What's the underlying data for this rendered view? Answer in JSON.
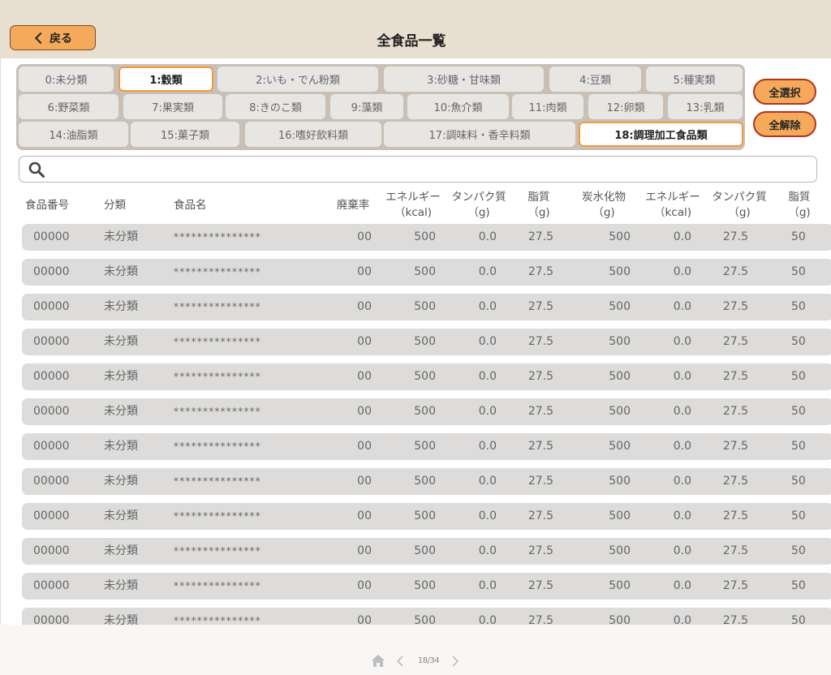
{
  "header": {
    "back_label": "戻る",
    "title": "全食品一覧"
  },
  "categories": [
    {
      "label": "0:未分類",
      "selected": false
    },
    {
      "label": "1:穀類",
      "selected": true
    },
    {
      "label": "2:いも・でん粉類",
      "selected": false
    },
    {
      "label": "3:砂糖・甘味類",
      "selected": false
    },
    {
      "label": "4:豆類",
      "selected": false
    },
    {
      "label": "5:種実類",
      "selected": false
    },
    {
      "label": "6:野菜類",
      "selected": false
    },
    {
      "label": "7:果実類",
      "selected": false
    },
    {
      "label": "8:きのこ類",
      "selected": false
    },
    {
      "label": "9:藻類",
      "selected": false
    },
    {
      "label": "10:魚介類",
      "selected": false
    },
    {
      "label": "11:肉類",
      "selected": false
    },
    {
      "label": "12:卵類",
      "selected": false
    },
    {
      "label": "13:乳類",
      "selected": false
    },
    {
      "label": "14:油脂類",
      "selected": false
    },
    {
      "label": "15:菓子類",
      "selected": false
    },
    {
      "label": "16:嗜好飲料類",
      "selected": false
    },
    {
      "label": "17:調味料・香辛料類",
      "selected": false
    },
    {
      "label": "18:調理加工食品類",
      "selected": true
    }
  ],
  "actions": {
    "select_all": "全選択",
    "deselect_all": "全解除"
  },
  "search": {
    "value": "",
    "placeholder": ""
  },
  "table": {
    "columns": [
      {
        "line1": "食品番号",
        "line2": ""
      },
      {
        "line1": "分類",
        "line2": ""
      },
      {
        "line1": "食品名",
        "line2": ""
      },
      {
        "line1": "廃棄率",
        "line2": ""
      },
      {
        "line1": "エネルギー",
        "line2": "（kcal)"
      },
      {
        "line1": "タンパク質",
        "line2": "（g)"
      },
      {
        "line1": "脂質",
        "line2": "（g)"
      },
      {
        "line1": "炭水化物",
        "line2": "（g)"
      },
      {
        "line1": "エネルギー",
        "line2": "（kcal)"
      },
      {
        "line1": "タンパク質",
        "line2": "（g)"
      },
      {
        "line1": "脂質",
        "line2": "（g)"
      }
    ],
    "rows": [
      [
        "00000",
        "未分類",
        "***************",
        "00",
        "500",
        "0.0",
        "27.5",
        "500",
        "0.0",
        "27.5",
        "50"
      ],
      [
        "00000",
        "未分類",
        "***************",
        "00",
        "500",
        "0.0",
        "27.5",
        "500",
        "0.0",
        "27.5",
        "50"
      ],
      [
        "00000",
        "未分類",
        "***************",
        "00",
        "500",
        "0.0",
        "27.5",
        "500",
        "0.0",
        "27.5",
        "50"
      ],
      [
        "00000",
        "未分類",
        "***************",
        "00",
        "500",
        "0.0",
        "27.5",
        "500",
        "0.0",
        "27.5",
        "50"
      ],
      [
        "00000",
        "未分類",
        "***************",
        "00",
        "500",
        "0.0",
        "27.5",
        "500",
        "0.0",
        "27.5",
        "50"
      ],
      [
        "00000",
        "未分類",
        "***************",
        "00",
        "500",
        "0.0",
        "27.5",
        "500",
        "0.0",
        "27.5",
        "50"
      ],
      [
        "00000",
        "未分類",
        "***************",
        "00",
        "500",
        "0.0",
        "27.5",
        "500",
        "0.0",
        "27.5",
        "50"
      ],
      [
        "00000",
        "未分類",
        "***************",
        "00",
        "500",
        "0.0",
        "27.5",
        "500",
        "0.0",
        "27.5",
        "50"
      ],
      [
        "00000",
        "未分類",
        "***************",
        "00",
        "500",
        "0.0",
        "27.5",
        "500",
        "0.0",
        "27.5",
        "50"
      ],
      [
        "00000",
        "未分類",
        "***************",
        "00",
        "500",
        "0.0",
        "27.5",
        "500",
        "0.0",
        "27.5",
        "50"
      ],
      [
        "00000",
        "未分類",
        "***************",
        "00",
        "500",
        "0.0",
        "27.5",
        "500",
        "0.0",
        "27.5",
        "50"
      ],
      [
        "00000",
        "未分類",
        "***************",
        "00",
        "500",
        "0.0",
        "27.5",
        "500",
        "0.0",
        "27.5",
        "50"
      ]
    ]
  },
  "pagination": {
    "page": "18/34"
  },
  "icons": {
    "back": "chevron-left-icon",
    "search": "search-icon",
    "home": "home-icon",
    "prev": "chevron-left-icon",
    "next": "chevron-right-icon"
  },
  "colors": {
    "header_bg": "#e9dfd0",
    "accent": "#f5a95b",
    "accent_border": "#b4321e",
    "selected_border": "#f39a3d",
    "row_bg": "#dddcdb"
  }
}
